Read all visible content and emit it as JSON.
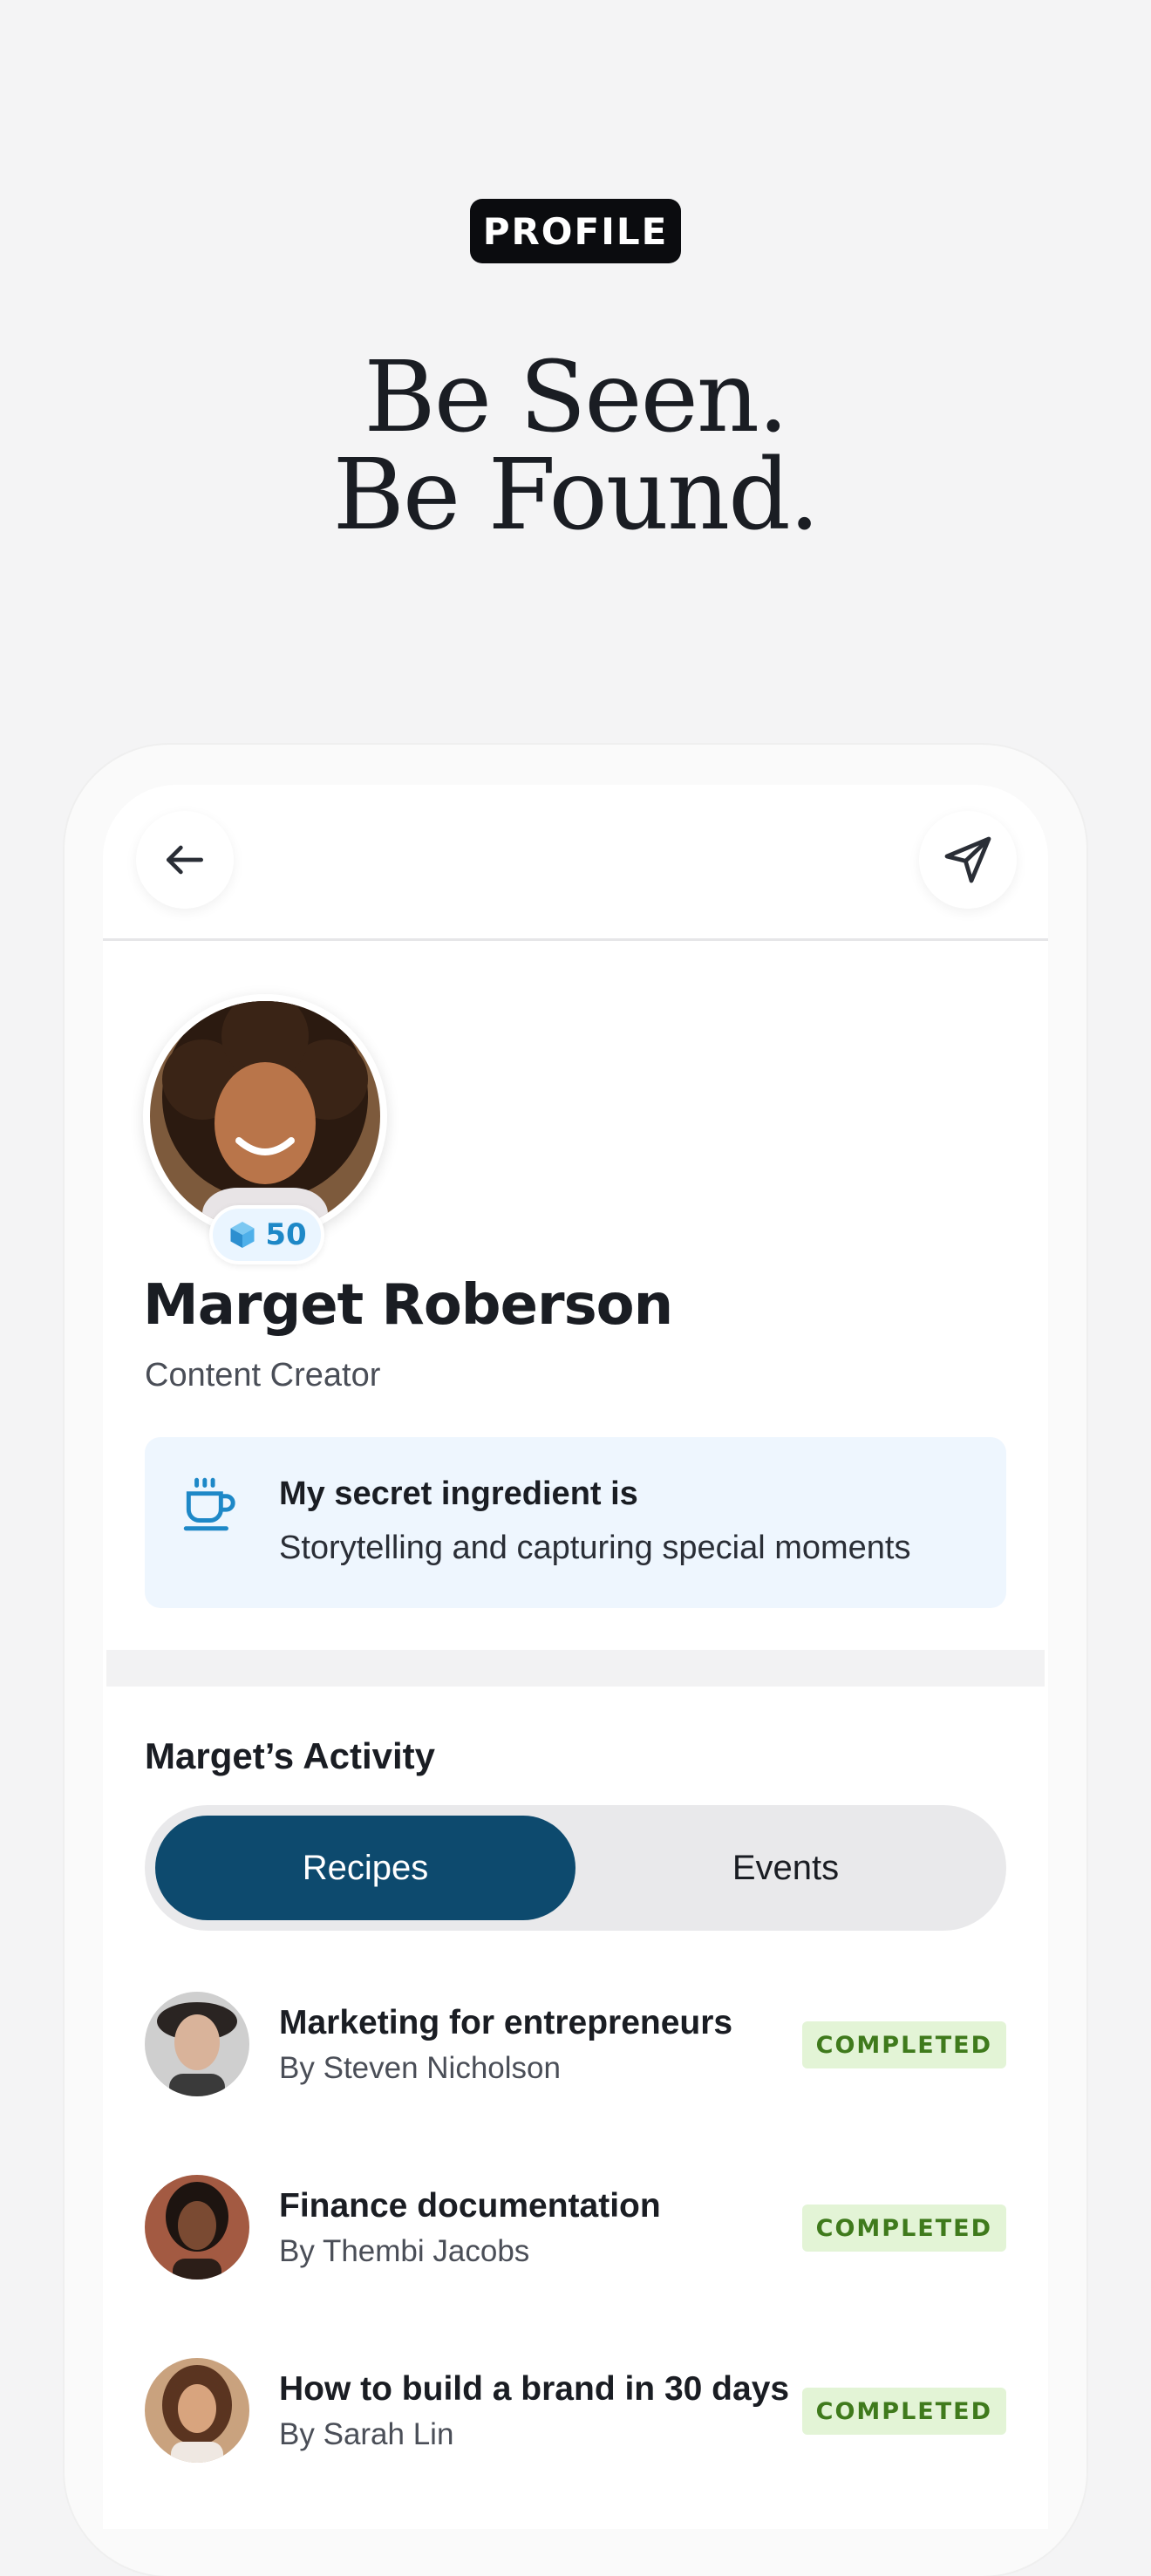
{
  "header": {
    "badge": "PROFILE",
    "headline_line1": "Be Seen.",
    "headline_line2": "Be Found."
  },
  "profile": {
    "name": "Marget Roberson",
    "role": "Content Creator",
    "points": "50",
    "secret_label": "My secret ingredient is",
    "secret_text": "Storytelling and capturing special moments"
  },
  "activity": {
    "title": "Marget’s Activity",
    "tabs": [
      {
        "label": "Recipes",
        "active": true
      },
      {
        "label": "Events",
        "active": false
      }
    ],
    "items": [
      {
        "title": "Marketing for entrepreneurs",
        "by_prefix": "By",
        "author": "Steven Nicholson",
        "status": "COMPLETED"
      },
      {
        "title": "Finance documentation",
        "by_prefix": "By",
        "author": "Thembi Jacobs",
        "status": "COMPLETED"
      },
      {
        "title": "How to build a brand in 30 days",
        "by_prefix": "By",
        "author": "Sarah Lin",
        "status": "COMPLETED"
      }
    ]
  },
  "colors": {
    "accent": "#0d4a6e",
    "status_bg": "#e3f4d6",
    "status_text": "#3f7a1c",
    "points_text": "#1e88c7"
  },
  "icons": {
    "back": "arrow-left-icon",
    "send": "paper-plane-icon",
    "secret": "coffee-cup-icon",
    "points": "cube-icon"
  }
}
